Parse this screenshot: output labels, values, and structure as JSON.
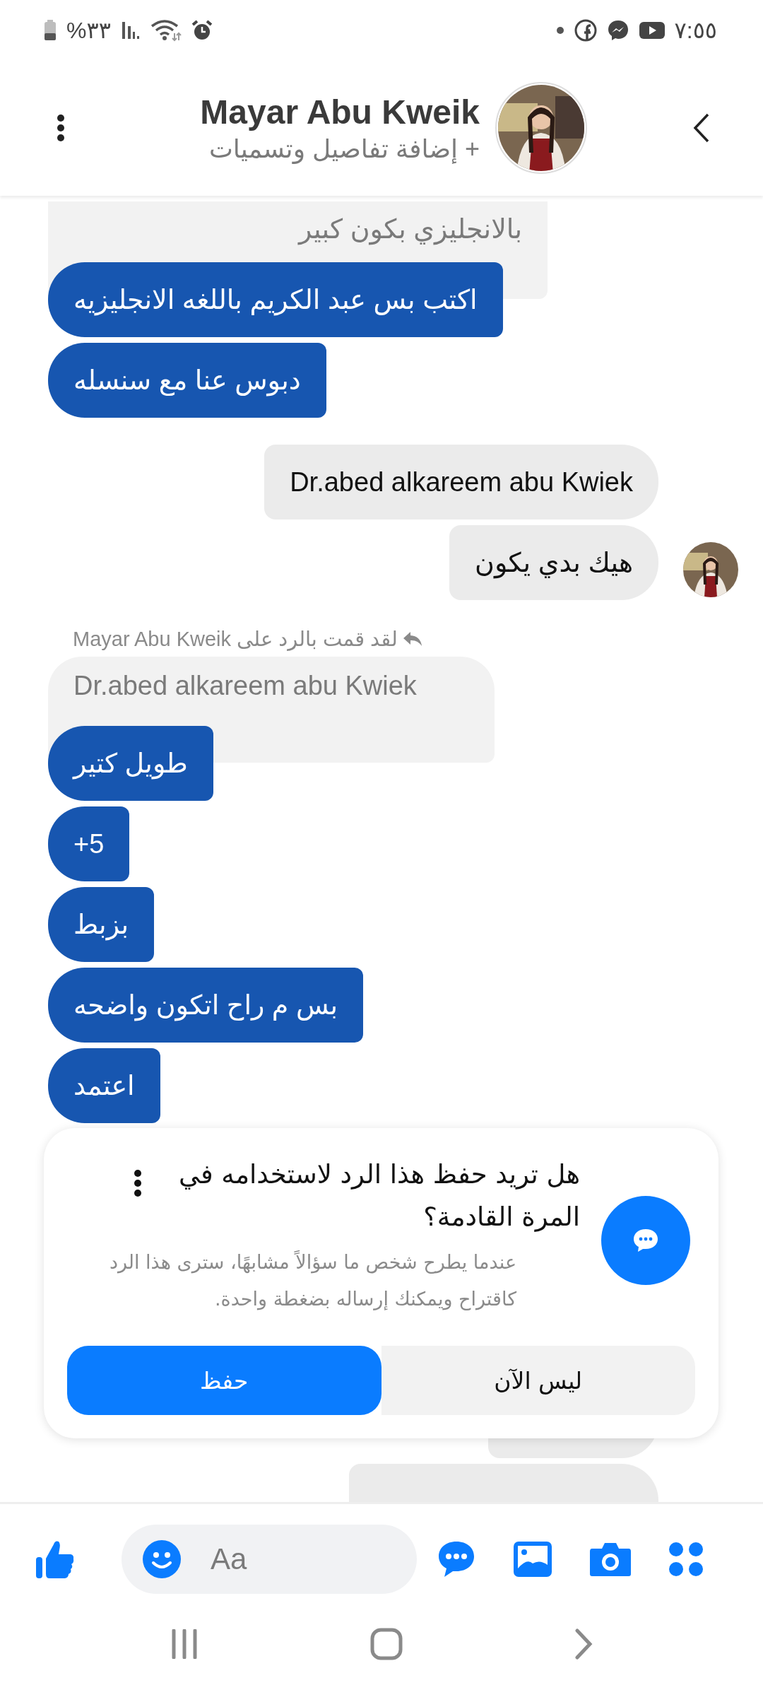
{
  "status_bar": {
    "battery": "%٣٣",
    "time": "٧:٥٥"
  },
  "header": {
    "name": "Mayar Abu Kweik",
    "subtitle": "+ إضافة تفاصيل وتسميات"
  },
  "messages": [
    {
      "kind": "quote",
      "text": "بالانجليزي بكون كبير"
    },
    {
      "kind": "received",
      "text": "اكتب بس عبد الكريم  باللغه الانجليزيه"
    },
    {
      "kind": "received",
      "text": "دبوس عنا مع سنسله"
    },
    {
      "kind": "sent",
      "text": "Dr.abed alkareem abu Kwiek",
      "seen": false
    },
    {
      "kind": "sent",
      "text": "هيك بدي يكون",
      "seen": true
    },
    {
      "kind": "reply_label",
      "text": "لقد قمت بالرد على Mayar Abu Kweik"
    },
    {
      "kind": "quote",
      "text": "Dr.abed alkareem abu Kwiek"
    },
    {
      "kind": "received",
      "text": "طويل كتير"
    },
    {
      "kind": "received",
      "text": "+5"
    },
    {
      "kind": "received",
      "text": "بزبط"
    },
    {
      "kind": "received",
      "text": "بس م راح اتكون واضحه"
    },
    {
      "kind": "received",
      "text": "اعتمد"
    },
    {
      "kind": "sent_covered"
    },
    {
      "kind": "sent_covered"
    }
  ],
  "save_reply_dialog": {
    "title": "هل تريد حفظ هذا الرد لاستخدامه في المرة القادمة؟",
    "description": "عندما يطرح شخص ما سؤالاً مشابهًا، سترى هذا الرد كاقتراح ويمكنك إرساله بضغطة واحدة.",
    "buttons": [
      {
        "label": "ليس الآن",
        "primary": false
      },
      {
        "label": "حفظ",
        "primary": true
      }
    ]
  },
  "composer": {
    "placeholder": "Aa"
  }
}
